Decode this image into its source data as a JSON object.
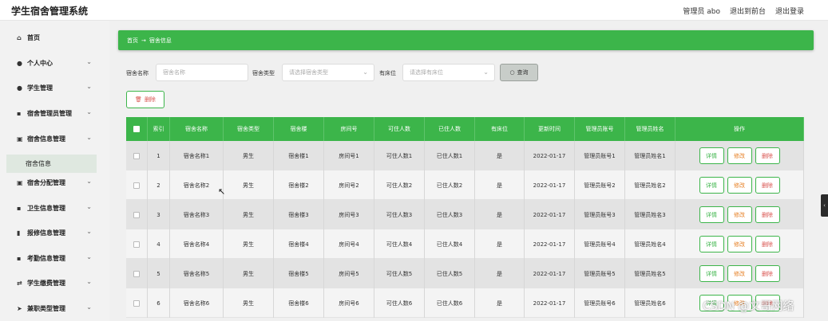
{
  "header": {
    "title": "学生宿舍管理系统",
    "admin_label": "管理员 abo",
    "to_front": "退出到前台",
    "logout": "退出登录"
  },
  "sidebar": {
    "items": [
      {
        "icon": "home-icon",
        "glyph": "⌂",
        "label": "首页"
      },
      {
        "icon": "user-icon",
        "glyph": "●",
        "label": "个人中心"
      },
      {
        "icon": "student-icon",
        "glyph": "●",
        "label": "学生管理"
      },
      {
        "icon": "grid-icon",
        "glyph": "▪",
        "label": "宿舍管理员管理"
      },
      {
        "icon": "building-icon",
        "glyph": "▣",
        "label": "宿舍信息管理"
      },
      {
        "icon": "building-icon",
        "glyph": "▣",
        "label": "宿舍分配管理"
      },
      {
        "icon": "grid-icon",
        "glyph": "▪",
        "label": "卫生信息管理"
      },
      {
        "icon": "bar-chart-icon",
        "glyph": "▮",
        "label": "报修信息管理"
      },
      {
        "icon": "grid-icon",
        "glyph": "▪",
        "label": "考勤信息管理"
      },
      {
        "icon": "transfer-icon",
        "glyph": "⇄",
        "label": "学生缴费管理"
      },
      {
        "icon": "send-icon",
        "glyph": "➤",
        "label": "兼职类型管理"
      }
    ],
    "active_sub": "宿舍信息"
  },
  "breadcrumb": {
    "home": "首页",
    "separator": "→",
    "current": "宿舍信息"
  },
  "filters": {
    "name_label": "宿舍名称",
    "name_placeholder": "宿舍名称",
    "type_label": "宿舍类型",
    "type_placeholder": "请选择宿舍类型",
    "bed_label": "有床位",
    "bed_placeholder": "请选择有床位",
    "search_label": "查询"
  },
  "toolbar": {
    "delete_label": "删除"
  },
  "table": {
    "columns": [
      "",
      "索引",
      "宿舍名称",
      "宿舍类型",
      "宿舍楼",
      "房间号",
      "可住人数",
      "已住人数",
      "有床位",
      "更新时间",
      "管理员账号",
      "管理员姓名",
      "操作"
    ],
    "rows": [
      {
        "index": "1",
        "name": "宿舍名称1",
        "type": "男生",
        "building": "宿舍楼1",
        "room": "房间号1",
        "capacity": "可住人数1",
        "occupied": "已住人数1",
        "has_bed": "是",
        "updated": "2022-01-17",
        "admin_account": "管理员账号1",
        "admin_name": "管理员姓名1"
      },
      {
        "index": "2",
        "name": "宿舍名称2",
        "type": "男生",
        "building": "宿舍楼2",
        "room": "房间号2",
        "capacity": "可住人数2",
        "occupied": "已住人数2",
        "has_bed": "是",
        "updated": "2022-01-17",
        "admin_account": "管理员账号2",
        "admin_name": "管理员姓名2"
      },
      {
        "index": "3",
        "name": "宿舍名称3",
        "type": "男生",
        "building": "宿舍楼3",
        "room": "房间号3",
        "capacity": "可住人数3",
        "occupied": "已住人数3",
        "has_bed": "是",
        "updated": "2022-01-17",
        "admin_account": "管理员账号3",
        "admin_name": "管理员姓名3"
      },
      {
        "index": "4",
        "name": "宿舍名称4",
        "type": "男生",
        "building": "宿舍楼4",
        "room": "房间号4",
        "capacity": "可住人数4",
        "occupied": "已住人数4",
        "has_bed": "是",
        "updated": "2022-01-17",
        "admin_account": "管理员账号4",
        "admin_name": "管理员姓名4"
      },
      {
        "index": "5",
        "name": "宿舍名称5",
        "type": "男生",
        "building": "宿舍楼5",
        "room": "房间号5",
        "capacity": "可住人数5",
        "occupied": "已住人数5",
        "has_bed": "是",
        "updated": "2022-01-17",
        "admin_account": "管理员账号5",
        "admin_name": "管理员姓名5"
      },
      {
        "index": "6",
        "name": "宿舍名称6",
        "type": "男生",
        "building": "宿舍楼6",
        "room": "房间号6",
        "capacity": "可住人数6",
        "occupied": "已住人数6",
        "has_bed": "是",
        "updated": "2022-01-17",
        "admin_account": "管理员账号6",
        "admin_name": "管理员姓名6"
      }
    ],
    "actions": {
      "detail": "详情",
      "edit": "修改",
      "delete": "删除"
    }
  },
  "watermark": "CSDN @文哥网络",
  "colors": {
    "accent": "#3cb54a",
    "danger": "#d9534f",
    "warning": "#e67e22"
  }
}
